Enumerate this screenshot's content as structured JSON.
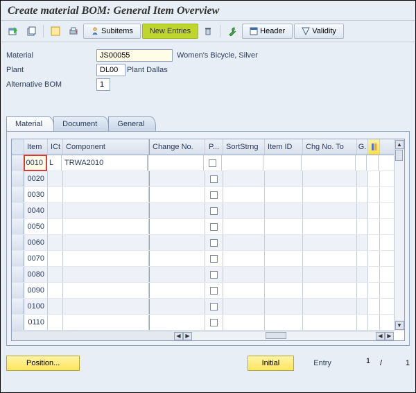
{
  "title": "Create material BOM: General Item Overview",
  "toolbar": {
    "subitems": "Subitems",
    "new_entries": "New Entries",
    "header": "Header",
    "validity": "Validity"
  },
  "form": {
    "material_label": "Material",
    "material_value": "JS00055",
    "material_desc": "Women's Bicycle, Silver",
    "plant_label": "Plant",
    "plant_value": "DL00",
    "plant_desc": "Plant Dallas",
    "altbom_label": "Alternative BOM",
    "altbom_value": "1"
  },
  "tabs": {
    "material": "Material",
    "document": "Document",
    "general": "General"
  },
  "grid": {
    "headers": {
      "item": "Item",
      "ict": "ICt",
      "component": "Component",
      "change_no": "Change No.",
      "p": "P...",
      "sort": "SortStrng",
      "item_id": "Item ID",
      "chg_to": "Chg No. To",
      "g": "G."
    },
    "rows": [
      {
        "item": "0010",
        "ict": "L",
        "component": "TRWA2010"
      },
      {
        "item": "0020",
        "ict": "",
        "component": ""
      },
      {
        "item": "0030",
        "ict": "",
        "component": ""
      },
      {
        "item": "0040",
        "ict": "",
        "component": ""
      },
      {
        "item": "0050",
        "ict": "",
        "component": ""
      },
      {
        "item": "0060",
        "ict": "",
        "component": ""
      },
      {
        "item": "0070",
        "ict": "",
        "component": ""
      },
      {
        "item": "0080",
        "ict": "",
        "component": ""
      },
      {
        "item": "0090",
        "ict": "",
        "component": ""
      },
      {
        "item": "0100",
        "ict": "",
        "component": ""
      },
      {
        "item": "0110",
        "ict": "",
        "component": ""
      }
    ]
  },
  "footer": {
    "position": "Position...",
    "initial": "Initial",
    "entry_label": "Entry",
    "entry_cur": "1",
    "entry_sep": "/",
    "entry_tot": "1"
  }
}
